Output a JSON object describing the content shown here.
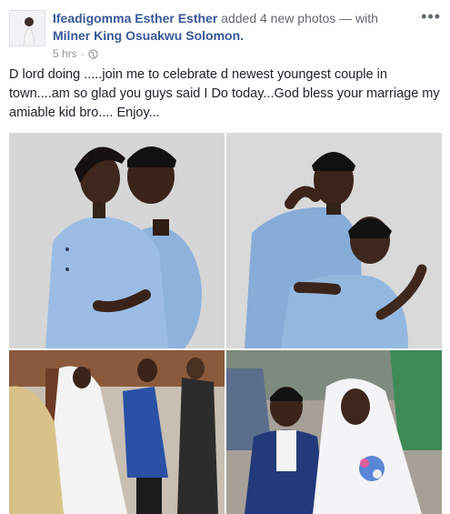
{
  "post": {
    "author": "Ifeadigomma Esther Esther",
    "action": "added 4 new photos",
    "with_text": "— with",
    "tagged": "Milner King Osuakwu Solomon.",
    "time": "5 hrs",
    "separator": "·",
    "more": "•••",
    "message": "D lord doing .....join me to celebrate d newest youngest couple in town....am so glad you guys said I Do today...God bless your marriage my amiable kid bro.... Enjoy..."
  },
  "icons": {
    "privacy": "globe-icon",
    "more": "more-options-icon"
  },
  "colors": {
    "link": "#365899",
    "text": "#1d2129",
    "meta": "#90949c",
    "outfit_blue": "#8fb4dd"
  }
}
